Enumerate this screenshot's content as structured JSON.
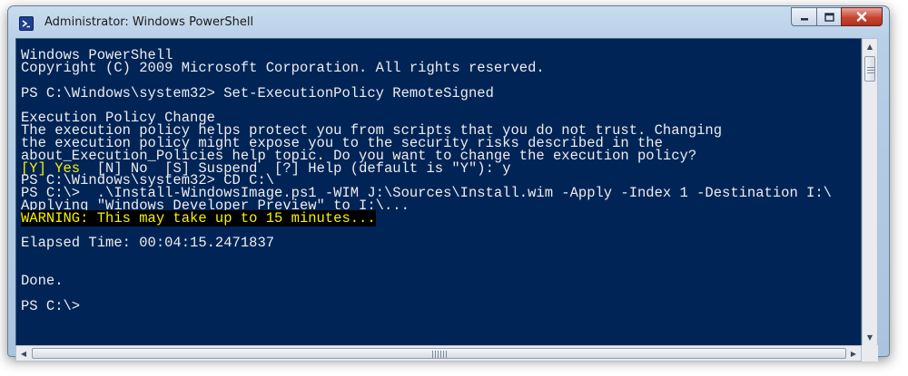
{
  "window": {
    "title": "Administrator: Windows PowerShell",
    "icon": "powershell-icon"
  },
  "controls": {
    "minimize": "minimize-icon",
    "maximize": "maximize-icon",
    "close": "close-icon"
  },
  "console": {
    "background": "#012456",
    "text_color": "#ededed",
    "warning_color": "#f5f201",
    "lines": [
      "Windows PowerShell",
      "Copyright (C) 2009 Microsoft Corporation. All rights reserved.",
      "",
      "PS C:\\Windows\\system32> Set-ExecutionPolicy RemoteSigned",
      "",
      "Execution Policy Change",
      "The execution policy helps protect you from scripts that you do not trust. Changing",
      "the execution policy might expose you to the security risks described in the",
      "about_Execution_Policies help topic. Do you want to change the execution policy?",
      "  [N] No  [S] Suspend  [?] Help (default is \"Y\"): y",
      "PS C:\\Windows\\system32> CD C:\\",
      "PS C:\\>  .\\Install-WindowsImage.ps1 -WIM J:\\Sources\\Install.wim -Apply -Index 1 -Destination I:\\",
      "Applying \"Windows Developer Preview\" to I:\\...",
      "WARNING: This may take up to 15 minutes...",
      "",
      "Elapsed Time: 00:04:15.2471837",
      "",
      "",
      "Done.",
      "",
      "PS C:\\>"
    ],
    "prompt_yes": "[Y] Yes"
  }
}
